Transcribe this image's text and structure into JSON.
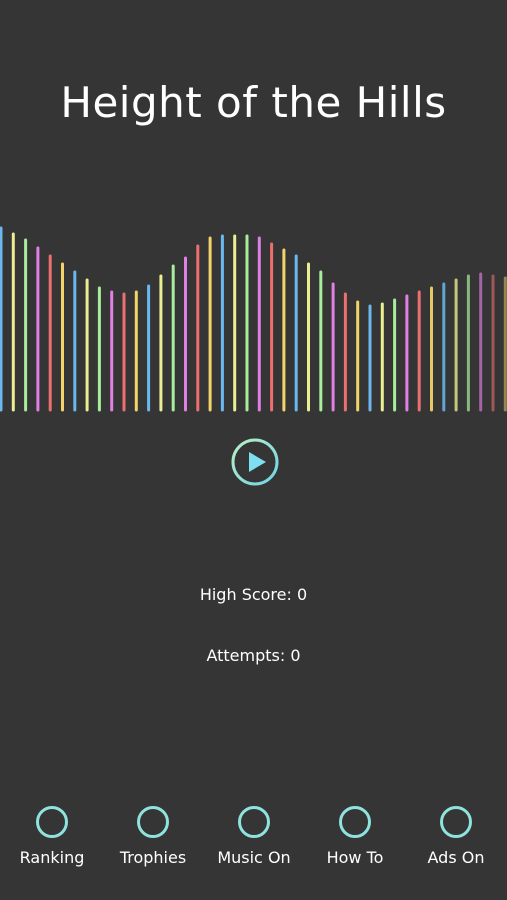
{
  "title": "Height of the Hills",
  "play_icon": "play-icon",
  "stats": {
    "high_score": "High Score: 0",
    "attempts": "Attempts: 0"
  },
  "nav": [
    {
      "label": "Ranking",
      "icon": "circle-icon"
    },
    {
      "label": "Trophies",
      "icon": "circle-icon"
    },
    {
      "label": "Music On",
      "icon": "circle-icon"
    },
    {
      "label": "How To",
      "icon": "circle-icon"
    },
    {
      "label": "Ads On",
      "icon": "circle-icon"
    }
  ],
  "colors": {
    "background": "#353535",
    "accent": "#8fe3df",
    "bar_palette": [
      "#6ab8ef",
      "#ecee92",
      "#a8ed9b",
      "#e07fe4",
      "#ee6f6f",
      "#f3d46a"
    ]
  }
}
